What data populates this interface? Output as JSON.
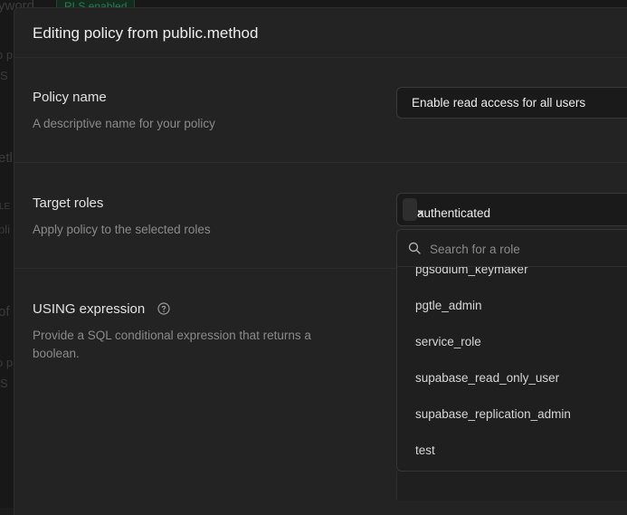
{
  "background": {
    "fragments": [
      "yword",
      "o p",
      "S",
      "etl",
      "LE",
      "pli",
      "of",
      "o p",
      "S"
    ],
    "badge": "RLS enabled"
  },
  "dialog": {
    "title": "Editing policy from public.method"
  },
  "policy_name": {
    "label": "Policy name",
    "description": "A descriptive name for your policy",
    "value": "Enable read access for all users"
  },
  "target_roles": {
    "label": "Target roles",
    "description": "Apply policy to the selected roles",
    "selected": [
      "authenticated"
    ],
    "remove_glyph": "×"
  },
  "using_expression": {
    "label": "USING expression",
    "description": "Provide a SQL conditional expression that returns a boolean."
  },
  "role_dropdown": {
    "search_placeholder": "Search for a role",
    "items": [
      "pgsodium_keymaker",
      "pgtle_admin",
      "service_role",
      "supabase_read_only_user",
      "supabase_replication_admin",
      "test"
    ]
  },
  "icons": {
    "help": "question-circle-icon",
    "search": "search-icon",
    "remove": "close-icon"
  },
  "colors": {
    "panel": "#232323",
    "input": "#1a1a1a",
    "accent_green": "#2f7a52"
  }
}
